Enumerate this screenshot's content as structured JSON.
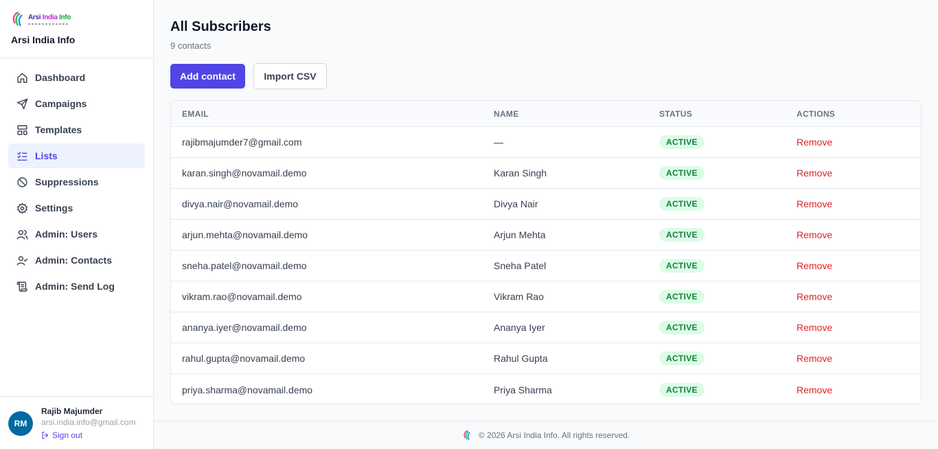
{
  "brand": {
    "logo_text": "Arsi India Info",
    "logo_words": [
      "Arsi",
      "India",
      "Info"
    ],
    "name": "Arsi India Info"
  },
  "nav": {
    "items": [
      {
        "label": "Dashboard",
        "icon": "home-icon",
        "active": false
      },
      {
        "label": "Campaigns",
        "icon": "send-icon",
        "active": false
      },
      {
        "label": "Templates",
        "icon": "layout-icon",
        "active": false
      },
      {
        "label": "Lists",
        "icon": "list-check-icon",
        "active": true
      },
      {
        "label": "Suppressions",
        "icon": "ban-icon",
        "active": false
      },
      {
        "label": "Settings",
        "icon": "gear-icon",
        "active": false
      },
      {
        "label": "Admin: Users",
        "icon": "users-icon",
        "active": false
      },
      {
        "label": "Admin: Contacts",
        "icon": "user-check-icon",
        "active": false
      },
      {
        "label": "Admin: Send Log",
        "icon": "scroll-icon",
        "active": false
      }
    ]
  },
  "user": {
    "initials": "RM",
    "name": "Rajib Majumder",
    "email": "arsi.india.info@gmail.com",
    "signout_label": "Sign out"
  },
  "page": {
    "title": "All Subscribers",
    "subtitle": "9 contacts"
  },
  "actions": {
    "add_label": "Add contact",
    "import_label": "Import CSV"
  },
  "table": {
    "headers": [
      "EMAIL",
      "NAME",
      "STATUS",
      "ACTIONS"
    ],
    "rows": [
      {
        "email": "rajibmajumder7@gmail.com",
        "name": "—",
        "status": "ACTIVE",
        "action": "Remove"
      },
      {
        "email": "karan.singh@novamail.demo",
        "name": "Karan Singh",
        "status": "ACTIVE",
        "action": "Remove"
      },
      {
        "email": "divya.nair@novamail.demo",
        "name": "Divya Nair",
        "status": "ACTIVE",
        "action": "Remove"
      },
      {
        "email": "arjun.mehta@novamail.demo",
        "name": "Arjun Mehta",
        "status": "ACTIVE",
        "action": "Remove"
      },
      {
        "email": "sneha.patel@novamail.demo",
        "name": "Sneha Patel",
        "status": "ACTIVE",
        "action": "Remove"
      },
      {
        "email": "vikram.rao@novamail.demo",
        "name": "Vikram Rao",
        "status": "ACTIVE",
        "action": "Remove"
      },
      {
        "email": "ananya.iyer@novamail.demo",
        "name": "Ananya Iyer",
        "status": "ACTIVE",
        "action": "Remove"
      },
      {
        "email": "rahul.gupta@novamail.demo",
        "name": "Rahul Gupta",
        "status": "ACTIVE",
        "action": "Remove"
      },
      {
        "email": "priya.sharma@novamail.demo",
        "name": "Priya Sharma",
        "status": "ACTIVE",
        "action": "Remove"
      }
    ]
  },
  "footer": {
    "text": "© 2026 Arsi India Info. All rights reserved."
  },
  "colors": {
    "accent": "#4f46e5",
    "active_nav_bg": "#eef2ff",
    "badge_bg": "#dcfce7",
    "badge_text": "#15803d",
    "danger": "#dc2626",
    "avatar": "#0369a1"
  }
}
